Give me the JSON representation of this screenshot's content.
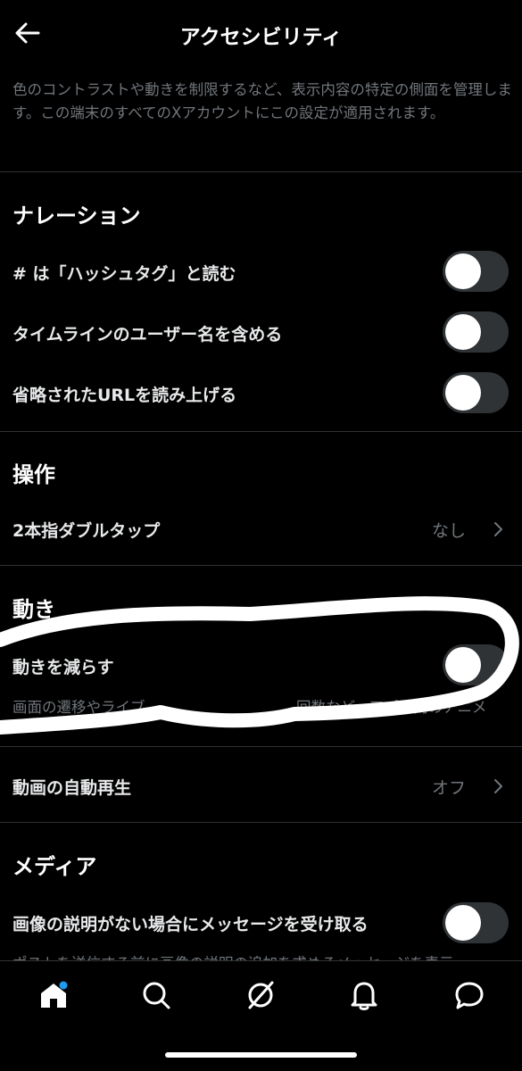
{
  "header": {
    "title": "アクセシビリティ"
  },
  "description": "色のコントラストや動きを制限するなど、表示内容の特定の側面を管理します。この端末のすべてのXアカウントにこの設定が適用されます。",
  "sections": {
    "narration": {
      "title": "ナレーション",
      "items": [
        {
          "label": "# は「ハッシュタグ」と読む",
          "state": "off"
        },
        {
          "label": "タイムラインのユーザー名を含める",
          "state": "off"
        },
        {
          "label": "省略されたURLを読み上げる",
          "state": "off"
        }
      ]
    },
    "operation": {
      "title": "操作",
      "two_finger_tap": {
        "label": "2本指ダブルタップ",
        "value": "なし"
      }
    },
    "motion": {
      "title": "動き",
      "reduce_motion": {
        "label": "動きを減らす",
        "state": "off",
        "subtext_left": "画面の遷移やライブ",
        "subtext_right": "回数など、アプリ内のアニメ"
      },
      "autoplay": {
        "label": "動画の自動再生",
        "value": "オフ"
      }
    },
    "media": {
      "title": "メディア",
      "alt_reminder": {
        "label": "画像の説明がない場合にメッセージを受け取る",
        "state": "off",
        "subtext": "ポストを送信する前に画像の説明の追加を求めるメッセージを表示"
      }
    }
  },
  "tabbar": {
    "icons": [
      "home-icon",
      "search-icon",
      "grok-icon",
      "notifications-icon",
      "messages-icon"
    ],
    "home_badge_color": "#1d9bf0"
  },
  "colors": {
    "background": "#000000",
    "text": "#e7e9ea",
    "muted": "#71767b",
    "toggle_off": "#2f3336",
    "accent": "#1d9bf0"
  }
}
